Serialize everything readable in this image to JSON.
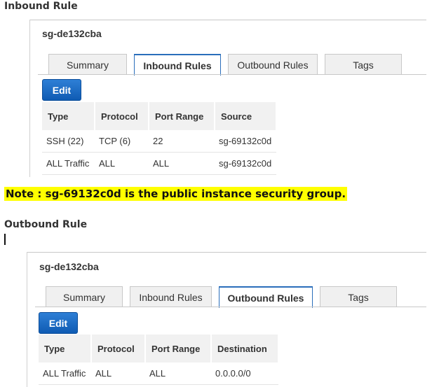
{
  "inbound": {
    "heading": "Inbound Rule",
    "sg_name": "sg-de132cba",
    "tabs": [
      "Summary",
      "Inbound Rules",
      "Outbound Rules",
      "Tags"
    ],
    "active_tab": "Inbound Rules",
    "edit_label": "Edit",
    "columns": [
      "Type",
      "Protocol",
      "Port Range",
      "Source"
    ],
    "rows": [
      [
        "SSH (22)",
        "TCP (6)",
        "22",
        "sg-69132c0d"
      ],
      [
        "ALL Traffic",
        "ALL",
        "ALL",
        "sg-69132c0d"
      ]
    ]
  },
  "note": "Note : sg-69132c0d is the public instance security group.",
  "outbound": {
    "heading": "Outbound Rule",
    "sg_name": "sg-de132cba",
    "tabs": [
      "Summary",
      "Inbound Rules",
      "Outbound Rules",
      "Tags"
    ],
    "active_tab": "Outbound Rules",
    "edit_label": "Edit",
    "columns": [
      "Type",
      "Protocol",
      "Port Range",
      "Destination"
    ],
    "rows": [
      [
        "ALL Traffic",
        "ALL",
        "ALL",
        "0.0.0.0/0"
      ]
    ]
  },
  "colors": {
    "accent_blue": "#2a6ebb",
    "button_blue": "#1a6cc8",
    "note_highlight": "#ffff00",
    "header_bg": "#f1f1f1"
  }
}
